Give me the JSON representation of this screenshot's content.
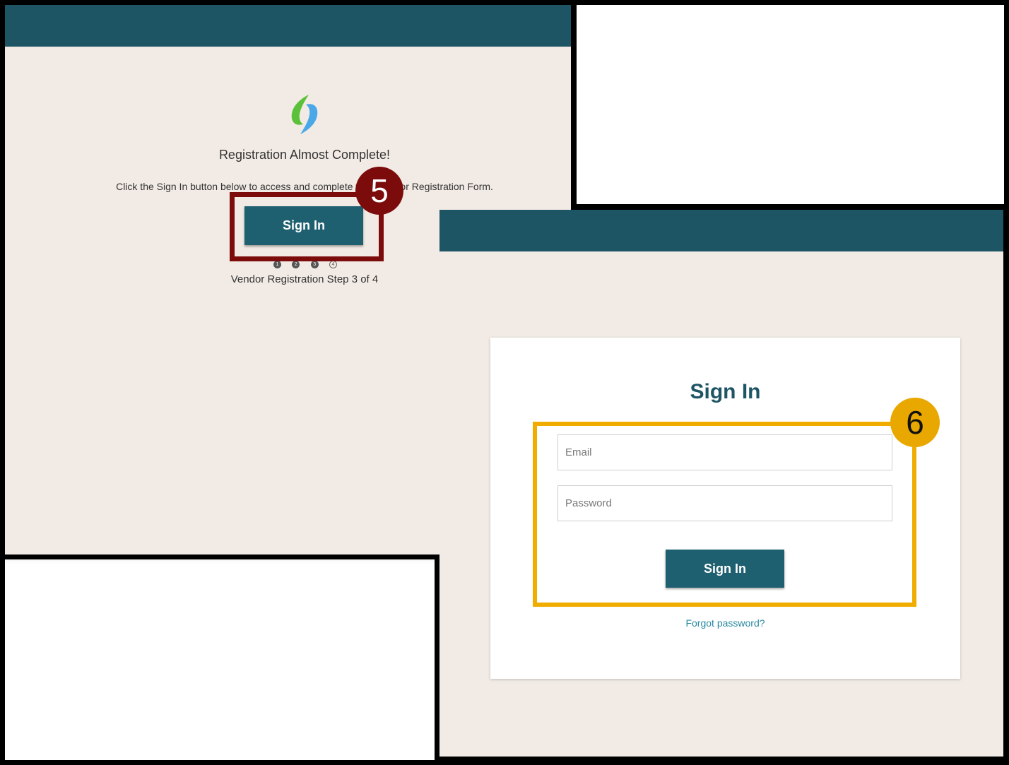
{
  "registration_panel": {
    "title": "Registration Almost Complete!",
    "description": "Click the Sign In button below to access and complete your Vendor Registration Form.",
    "sign_in_label": "Sign In",
    "step_markers": [
      "1",
      "2",
      "3",
      "4"
    ],
    "current_step": 3,
    "total_steps": 4,
    "step_text": "Vendor Registration Step 3 of 4",
    "callout_number": "5"
  },
  "sign_in_panel": {
    "title": "Sign In",
    "email_placeholder": "Email",
    "password_placeholder": "Password",
    "sign_in_label": "Sign In",
    "forgot_password": "Forgot password?",
    "callout_number": "6"
  },
  "colors": {
    "header": "#1e5565",
    "button": "#1e5f70",
    "panel_background": "#f2ebe5",
    "callout_5": "#7c0b0b",
    "callout_6": "#f0ad00",
    "link": "#2a8aa0"
  },
  "icons": {
    "logo": "green-blue-swirl-logo"
  }
}
